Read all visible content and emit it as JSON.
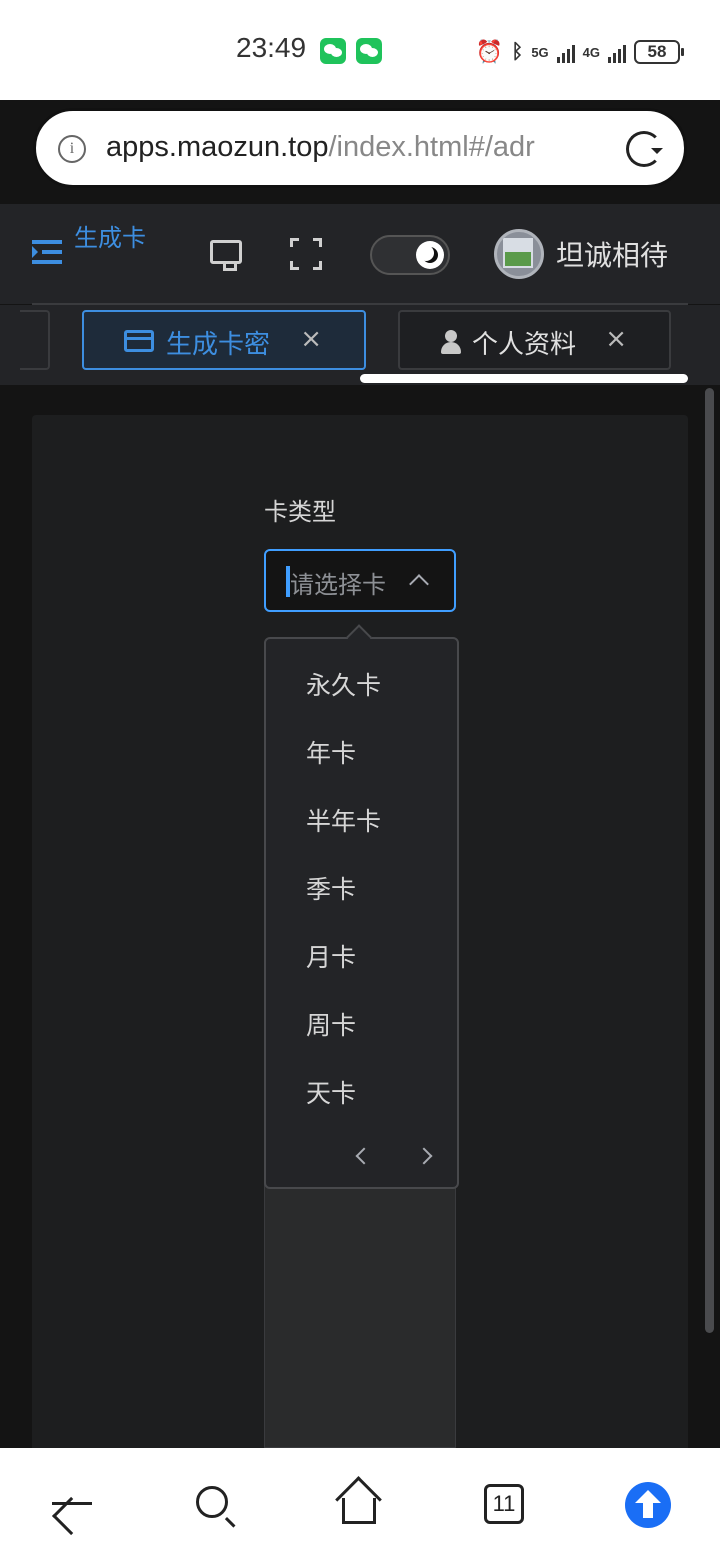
{
  "status_bar": {
    "time": "23:49",
    "network_1": "5G",
    "network_2": "4G",
    "battery": "58"
  },
  "browser": {
    "url_host": "apps.maozun.top",
    "url_path": "/index.html#/adr",
    "tab_count": "11"
  },
  "header": {
    "ghost_title": "生成卡\n密",
    "username": "坦诚相待"
  },
  "tabs": [
    {
      "label": "生成卡密",
      "close": "×",
      "active": true
    },
    {
      "label": "个人资料",
      "close": "×",
      "active": false
    }
  ],
  "form": {
    "card_type_label": "卡类型",
    "select_placeholder": "请选择卡",
    "options": [
      "永久卡",
      "年卡",
      "半年卡",
      "季卡",
      "月卡",
      "周卡",
      "天卡"
    ]
  },
  "colors": {
    "accent": "#409eff",
    "background": "#141414",
    "panel": "#1d1e1f"
  }
}
